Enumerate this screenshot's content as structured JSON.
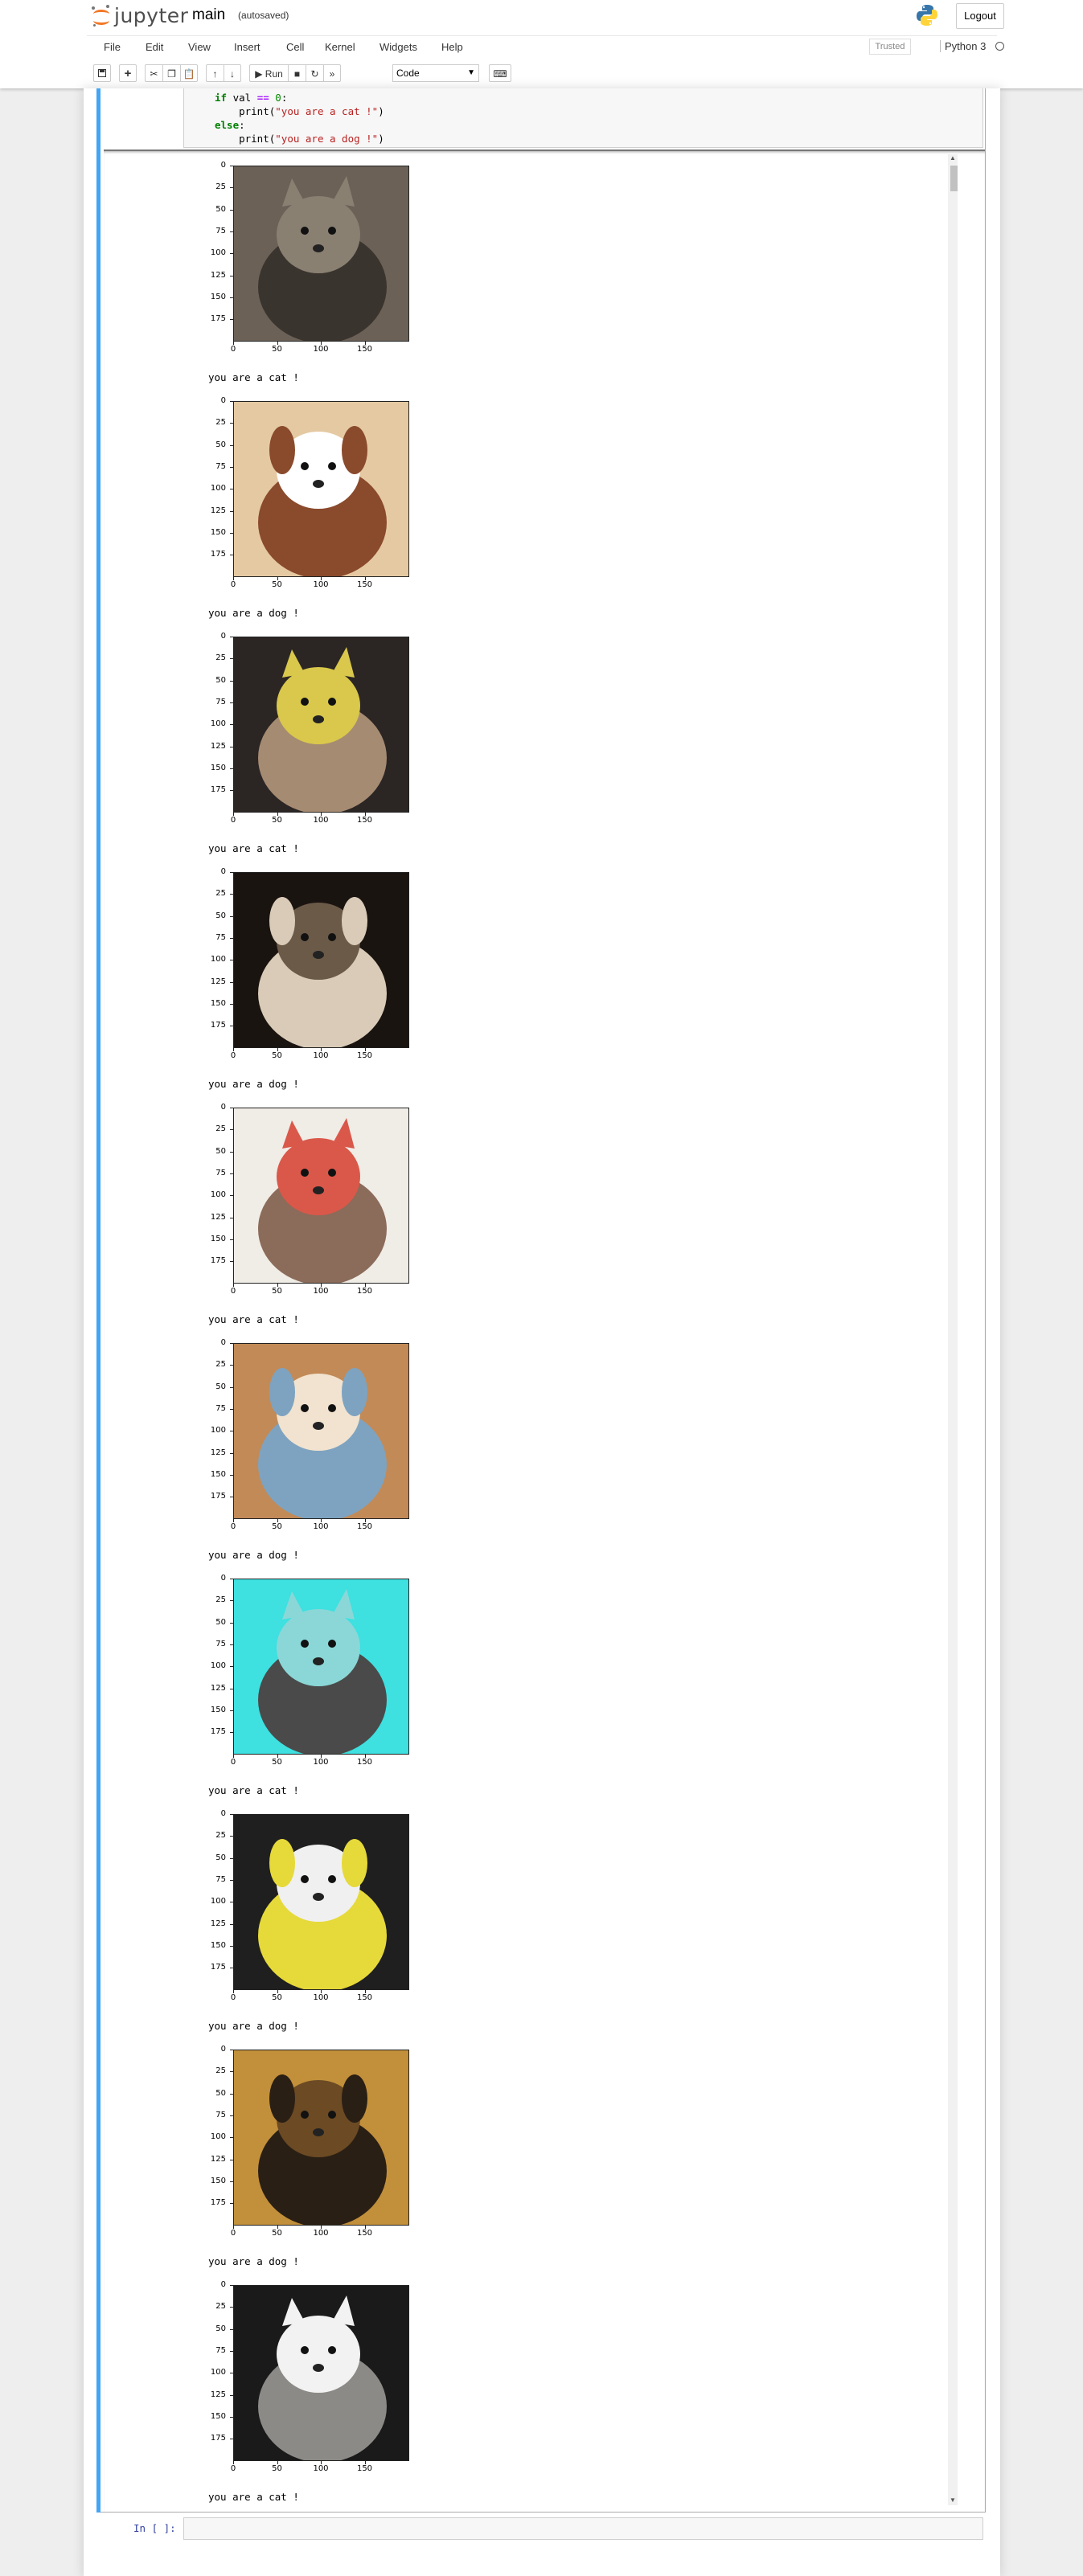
{
  "header": {
    "logo_text": "jupyter",
    "notebook_name": "main",
    "save_status": "(autosaved)",
    "logout_label": "Logout"
  },
  "menu": [
    "File",
    "Edit",
    "View",
    "Insert",
    "Cell",
    "Kernel",
    "Widgets",
    "Help"
  ],
  "kernel": {
    "trusted_label": "Trusted",
    "name": "Python 3"
  },
  "toolbar": {
    "run_label": "Run",
    "cell_type": "Code",
    "icons": [
      "save-icon",
      "plus-icon",
      "cut-icon",
      "copy-icon",
      "paste-icon",
      "move-up-icon",
      "move-down-icon",
      "run-icon",
      "stop-icon",
      "restart-icon",
      "fast-forward-icon",
      "keyboard-icon"
    ]
  },
  "code": {
    "line1": {
      "kw": "if",
      "rest_a": " val ",
      "op": "==",
      "rest_b": " ",
      "num": "0",
      "colon": ":"
    },
    "line2": {
      "fn": "    print(",
      "str": "\"you are a cat !\"",
      "close": ")"
    },
    "line3": {
      "kw": "else",
      "colon": ":"
    },
    "line4": {
      "fn": "    print(",
      "str": "\"you are a dog !\"",
      "close": ")"
    }
  },
  "outputs": [
    {
      "animal": "cat",
      "text": "you are a cat !",
      "palette": [
        "#6b6157",
        "#3a342e",
        "#8a8072"
      ]
    },
    {
      "animal": "dog",
      "text": "you are a dog !",
      "palette": [
        "#e5c9a2",
        "#8a4a2c",
        "#ffffff"
      ]
    },
    {
      "animal": "cat",
      "text": "you are a cat !",
      "palette": [
        "#2b2624",
        "#a68b73",
        "#d9c84b"
      ]
    },
    {
      "animal": "dog",
      "text": "you are a dog !",
      "palette": [
        "#1a1410",
        "#d9cbb8",
        "#6b5a48"
      ]
    },
    {
      "animal": "cat",
      "text": "you are a cat !",
      "palette": [
        "#f0ece6",
        "#8b6b5a",
        "#d9584a"
      ]
    },
    {
      "animal": "dog",
      "text": "you are a dog !",
      "palette": [
        "#c28a57",
        "#7ea3c0",
        "#f1e3cf"
      ]
    },
    {
      "animal": "cat",
      "text": "you are a cat !",
      "palette": [
        "#3ee0e0",
        "#4a4a4a",
        "#8bd7d7"
      ]
    },
    {
      "animal": "dog",
      "text": "you are a dog !",
      "palette": [
        "#1f1f1f",
        "#e6d93a",
        "#f0f0f0"
      ]
    },
    {
      "animal": "dog",
      "text": "you are a dog !",
      "palette": [
        "#c28f3a",
        "#2a1f14",
        "#6b4a24"
      ]
    },
    {
      "animal": "cat",
      "text": "you are a cat !",
      "palette": [
        "#1a1a1a",
        "#8c8a87",
        "#f2f2f2"
      ]
    }
  ],
  "axes": {
    "yticks": [
      "0",
      "25",
      "50",
      "75",
      "100",
      "125",
      "150",
      "175"
    ],
    "xticks": [
      "0",
      "50",
      "100",
      "150"
    ]
  },
  "next_cell": {
    "prompt": "In [ ]:"
  }
}
